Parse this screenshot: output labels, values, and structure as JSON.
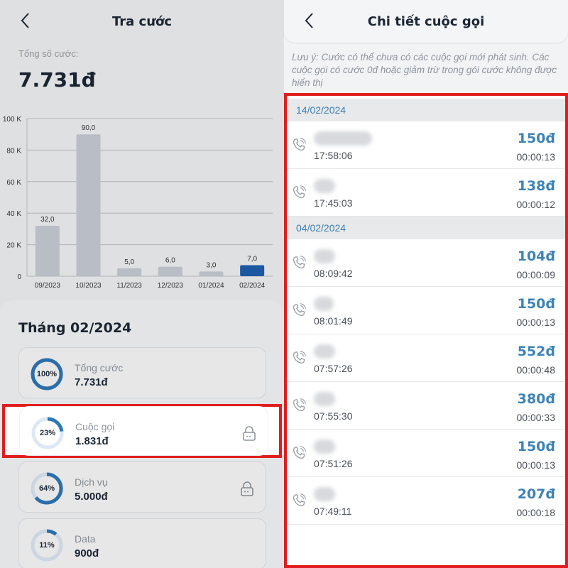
{
  "left": {
    "title": "Tra cước",
    "total_label": "Tổng số cước:",
    "total_value": "7.731đ",
    "month_title": "Tháng 02/2024",
    "fees": [
      {
        "pct": "100%",
        "pct_value": 100,
        "name": "Tổng cước",
        "value": "7.731đ",
        "locked": false
      },
      {
        "pct": "23%",
        "pct_value": 23,
        "name": "Cuộc gọi",
        "value": "1.831đ",
        "locked": true
      },
      {
        "pct": "64%",
        "pct_value": 64,
        "name": "Dịch vụ",
        "value": "5.000đ",
        "locked": true
      },
      {
        "pct": "11%",
        "pct_value": 11,
        "name": "Data",
        "value": "900đ",
        "locked": false
      }
    ]
  },
  "chart_data": {
    "type": "bar",
    "categories": [
      "09/2023",
      "10/2023",
      "11/2023",
      "12/2023",
      "01/2024",
      "02/2024"
    ],
    "values": [
      32.0,
      90.0,
      5.0,
      6.0,
      3.0,
      7.0
    ],
    "value_labels": [
      "32,0",
      "90,0",
      "5,0",
      "6,0",
      "3,0",
      "7,0"
    ],
    "yticks": [
      "0",
      "20 K",
      "40 K",
      "60 K",
      "80 K",
      "100 K"
    ],
    "ylim": [
      0,
      100
    ],
    "grid": true,
    "bar_color": "#c9ced6",
    "highlight_color": "#1f5fb0",
    "highlight_index": 5
  },
  "right": {
    "title": "Chi tiết cuộc gọi",
    "note": "Lưu ý: Cước có thể chưa có các cuộc gọi mới phát sinh. Các cuộc gọi có cước 0đ hoặc giảm trừ trong gói cước không được hiển thị",
    "groups": [
      {
        "date": "14/02/2024",
        "calls": [
          {
            "time": "17:58:06",
            "amount": "150đ",
            "duration": "00:00:13"
          },
          {
            "time": "17:45:03",
            "amount": "138đ",
            "duration": "00:00:12"
          }
        ]
      },
      {
        "date": "04/02/2024",
        "calls": [
          {
            "time": "08:09:42",
            "amount": "104đ",
            "duration": "00:00:09"
          },
          {
            "time": "08:01:49",
            "amount": "150đ",
            "duration": "00:00:13"
          },
          {
            "time": "07:57:26",
            "amount": "552đ",
            "duration": "00:00:48"
          },
          {
            "time": "07:55:30",
            "amount": "380đ",
            "duration": "00:00:33"
          },
          {
            "time": "07:51:26",
            "amount": "150đ",
            "duration": "00:00:13"
          },
          {
            "time": "07:49:11",
            "amount": "207đ",
            "duration": "00:00:18"
          }
        ]
      }
    ]
  },
  "colors": {
    "accent_blue": "#3c83b8",
    "highlight_red": "#e11e1e",
    "ring_blue": "#2f78b7"
  }
}
